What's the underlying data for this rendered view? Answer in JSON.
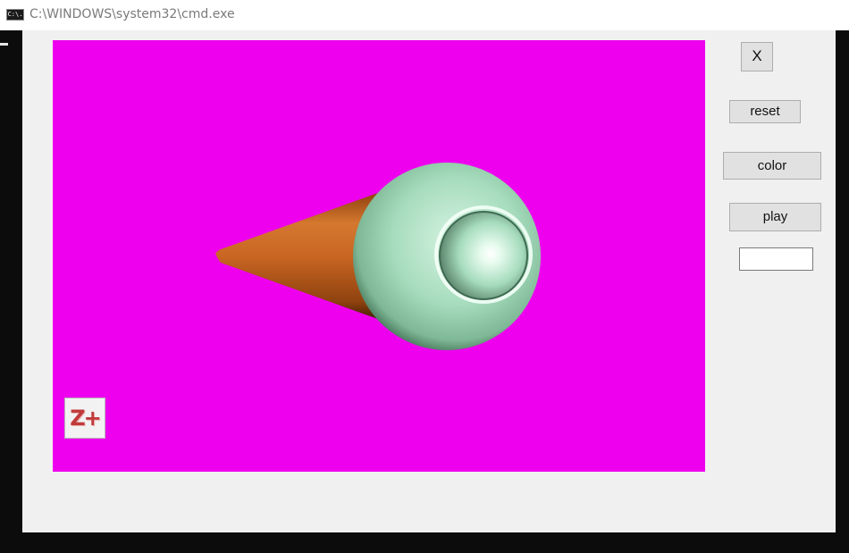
{
  "window": {
    "title": "C:\\WINDOWS\\system32\\cmd.exe",
    "icon": "cmd-icon",
    "icon_text": "C:\\."
  },
  "viewport": {
    "background_color": "#ee00ee",
    "objects": [
      {
        "name": "cone",
        "color": "#c96623"
      },
      {
        "name": "outer-sphere",
        "color": "#a6dcbd"
      },
      {
        "name": "inner-sphere",
        "color": "#a6dcbd"
      }
    ],
    "zoom_button_label": "Z+"
  },
  "controls": {
    "close_label": "X",
    "reset_label": "reset",
    "color_label": "color",
    "play_label": "play",
    "text_field_value": ""
  }
}
